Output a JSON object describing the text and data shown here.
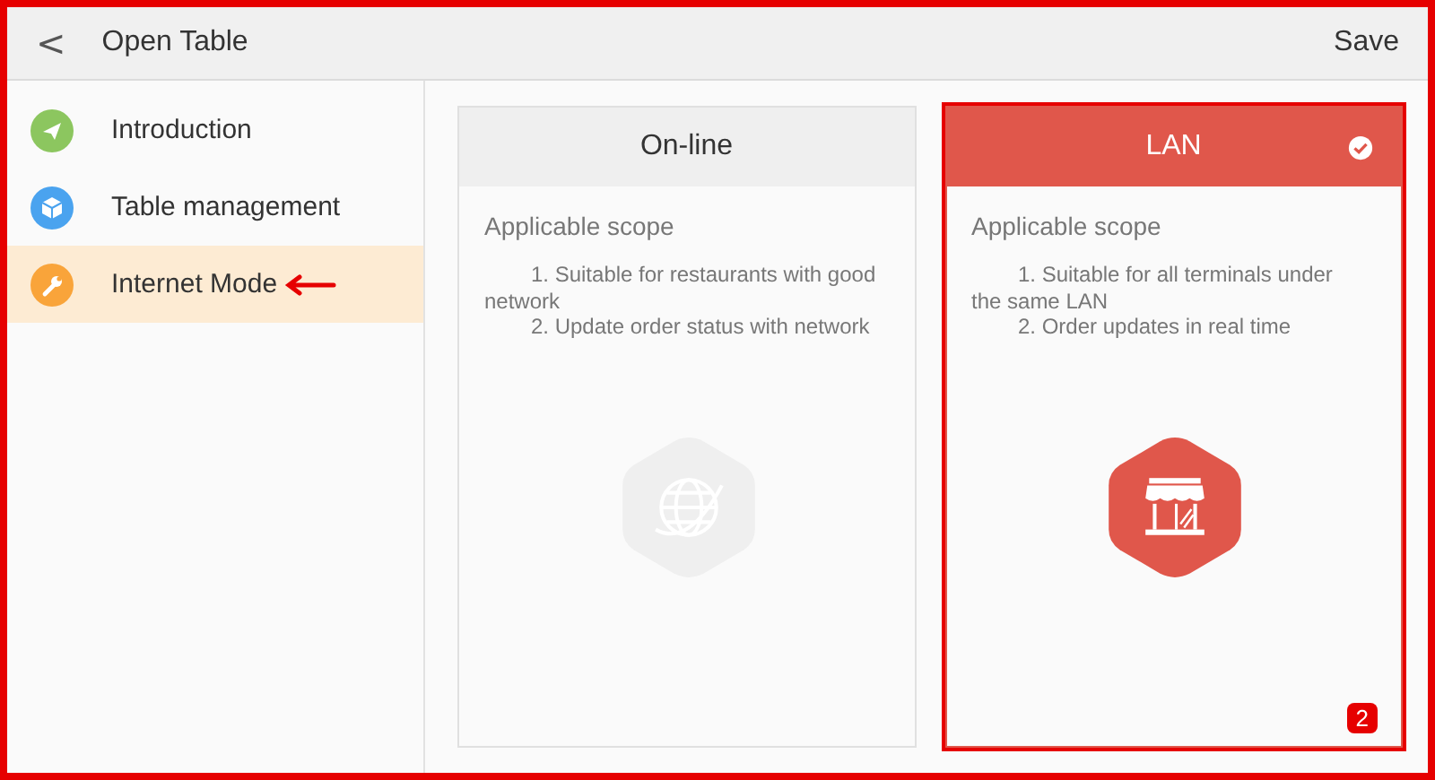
{
  "header": {
    "back": "<",
    "title": "Open Table",
    "action": "Save"
  },
  "sidebar": {
    "items": [
      {
        "label": "Introduction",
        "selected": false,
        "color": "#8cc65f",
        "kind": "plane",
        "pointer": false
      },
      {
        "label": "Table management",
        "selected": false,
        "color": "#4aa3ef",
        "kind": "cube",
        "pointer": false
      },
      {
        "label": "Internet Mode",
        "selected": true,
        "color": "#f9a43a",
        "kind": "wrench",
        "pointer": true
      }
    ]
  },
  "cards": [
    {
      "title": "On-line",
      "selected": false,
      "highlighted": false,
      "heading": "Applicable scope",
      "lines": [
        "1. Suitable for restaurants with good network",
        "2. Update order status with network"
      ],
      "kind": "globe"
    },
    {
      "title": "LAN",
      "selected": true,
      "highlighted": true,
      "step": "2",
      "heading": "Applicable scope",
      "lines": [
        "1. Suitable for all terminals under the same LAN",
        "2. Order updates in real time"
      ],
      "kind": "store"
    }
  ]
}
